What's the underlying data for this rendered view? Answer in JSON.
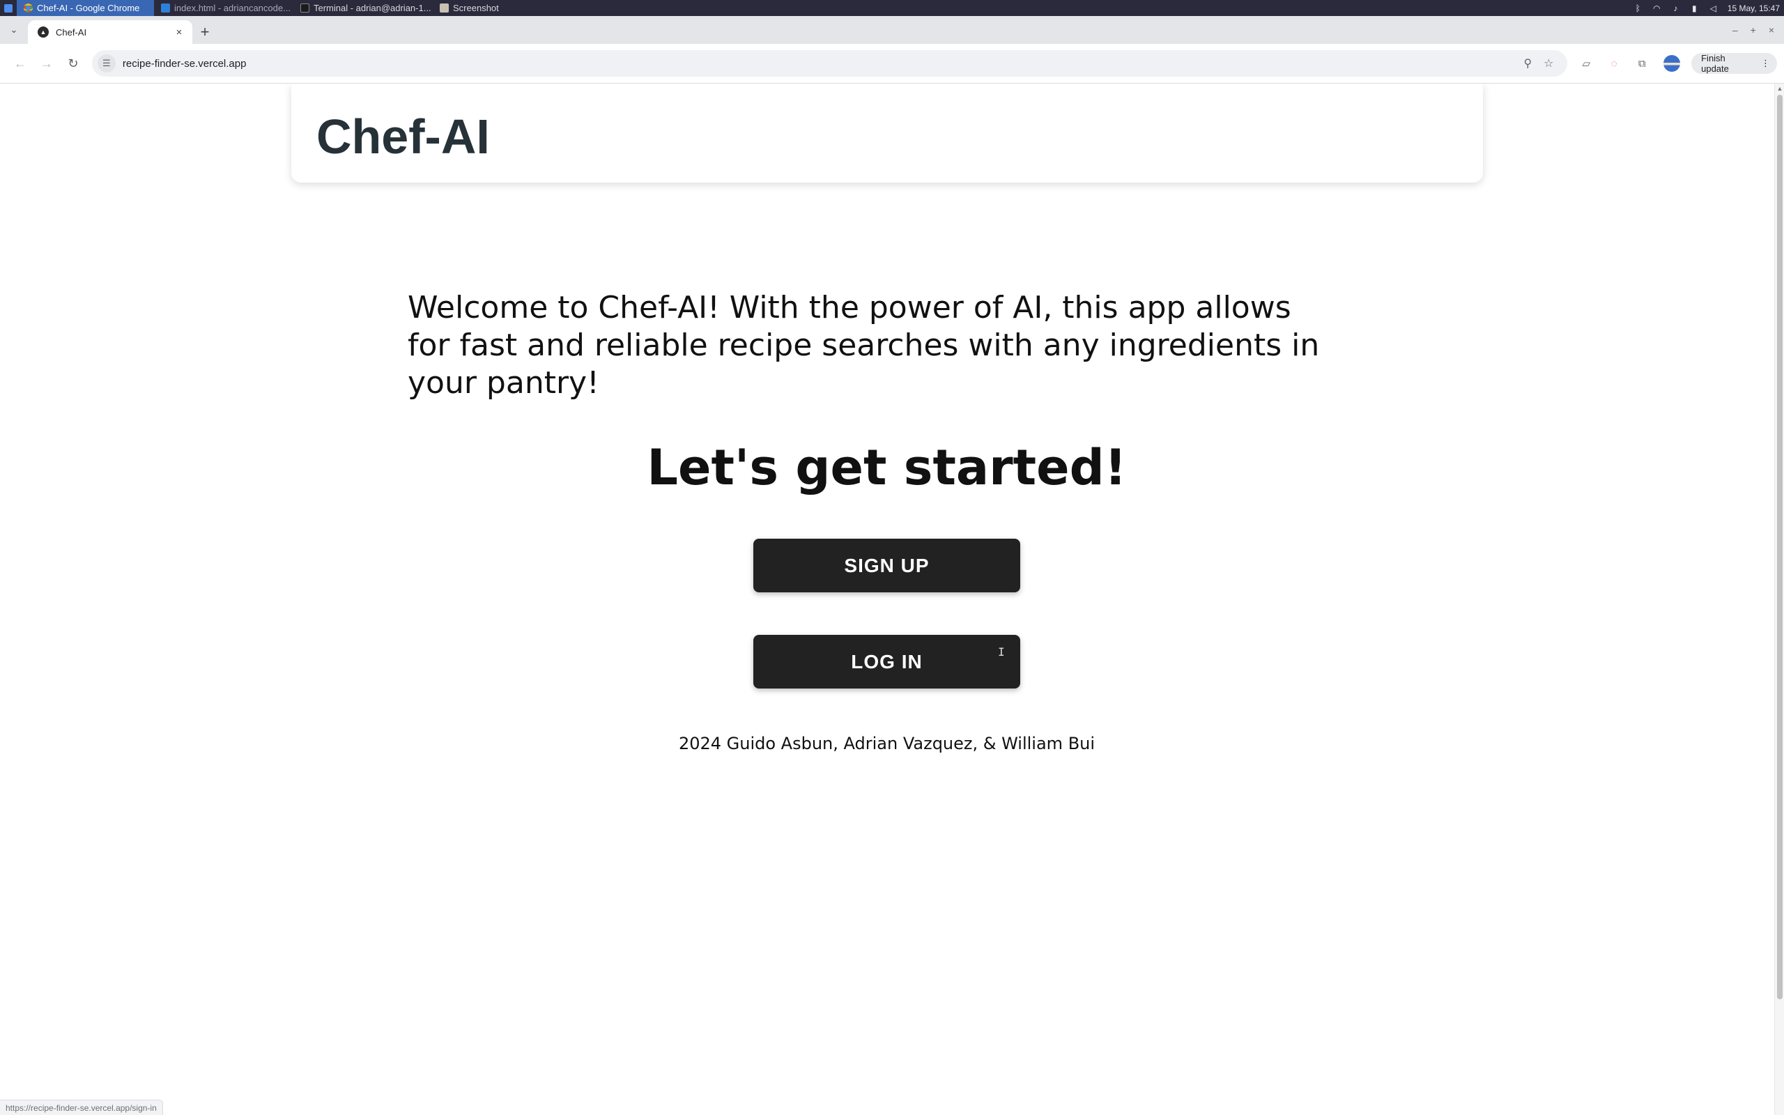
{
  "taskbar": {
    "tasks": [
      {
        "label": "Chef-AI - Google Chrome",
        "icon": "chrome-icon"
      },
      {
        "label": "index.html - adriancancode...",
        "icon": "vscode-icon"
      },
      {
        "label": "Terminal - adrian@adrian-1...",
        "icon": "terminal-icon"
      },
      {
        "label": "Screenshot",
        "icon": "screenshot-icon"
      }
    ],
    "tray_icons": [
      "bluetooth-icon",
      "wifi-icon",
      "notification-bell-icon",
      "battery-icon",
      "volume-icon"
    ],
    "clock": "15 May, 15:47"
  },
  "browser": {
    "tab": {
      "title": "Chef-AI",
      "close_glyph": "×"
    },
    "new_tab_glyph": "+",
    "url": "recipe-finder-se.vercel.app",
    "update_label": "Finish update",
    "status_url": "https://recipe-finder-se.vercel.app/sign-in"
  },
  "page": {
    "brand": "Chef-AI",
    "welcome": "Welcome to Chef-AI! With the power of AI, this app allows for fast and reliable recipe searches with any ingredients in your pantry!",
    "started": "Let's get started!",
    "signup_label": "SIGN UP",
    "login_label": "LOG IN",
    "footer": "2024 Guido Asbun, Adrian Vazquez, & William Bui"
  },
  "colors": {
    "button_bg": "#222222",
    "brand_text": "#263238",
    "taskbar_bg": "#2a2a3c",
    "active_task": "#3a67b3"
  }
}
